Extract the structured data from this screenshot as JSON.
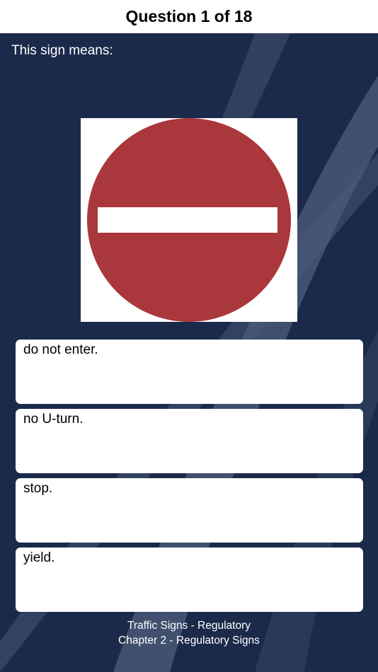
{
  "header": {
    "title": "Question 1 of 18"
  },
  "question": {
    "prompt": "This sign means:",
    "sign_icon": "do-not-enter-sign-icon",
    "sign_colors": {
      "circle": "#a9373b",
      "bar": "#ffffff"
    }
  },
  "answers": [
    {
      "label": "do not enter."
    },
    {
      "label": "no U-turn."
    },
    {
      "label": "stop."
    },
    {
      "label": "yield."
    }
  ],
  "footer": {
    "line1": "Traffic Signs - Regulatory",
    "line2": "Chapter 2 - Regulatory Signs"
  },
  "colors": {
    "background": "#1b2a4a",
    "header_bg": "#ffffff"
  }
}
